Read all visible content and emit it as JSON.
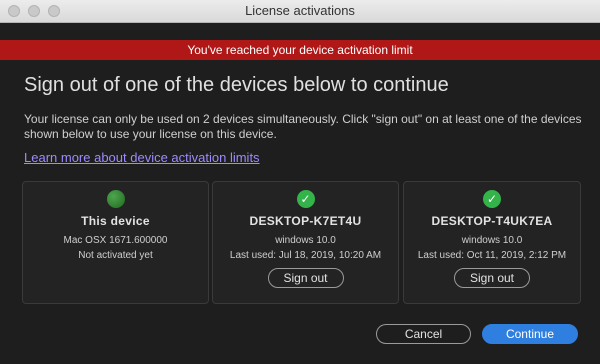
{
  "window": {
    "title": "License activations"
  },
  "banner": {
    "text": "You've reached your device activation limit",
    "color": "#b01818"
  },
  "heading": "Sign out of one of the devices below to continue",
  "description": "Your license can only be used on 2 devices simultaneously. Click \"sign out\" on at least one of the devices shown below to use your license on this device.",
  "learn_more": "Learn more about device activation limits",
  "devices": [
    {
      "name": "This device",
      "os": "Mac OSX 1671.600000",
      "status": "Not activated yet",
      "icon": "green-dot-icon"
    },
    {
      "name": "DESKTOP-K7ET4U",
      "os": "windows 10.0",
      "last_used": "Last used: Jul 18, 2019, 10:20 AM",
      "icon": "green-check-icon",
      "action": "Sign out"
    },
    {
      "name": "DESKTOP-T4UK7EA",
      "os": "windows 10.0",
      "last_used": "Last used: Oct 11, 2019, 2:12 PM",
      "icon": "green-check-icon",
      "action": "Sign out"
    }
  ],
  "buttons": {
    "cancel": "Cancel",
    "continue": "Continue"
  },
  "colors": {
    "accent": "#2e7fe0",
    "success": "#34b34a"
  },
  "check_glyph": "✓"
}
